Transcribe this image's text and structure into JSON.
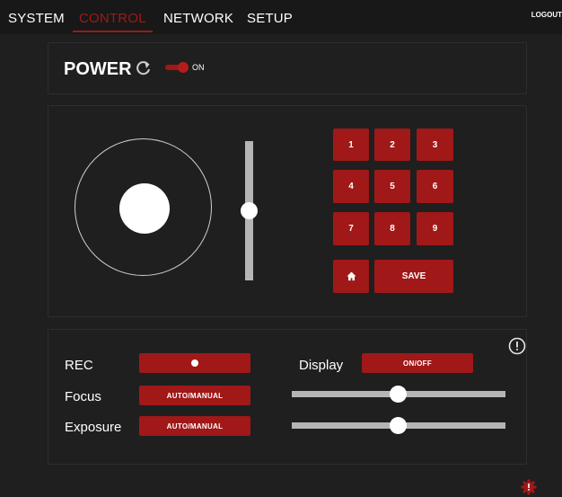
{
  "nav": {
    "tabs": [
      {
        "label": "SYSTEM"
      },
      {
        "label": "CONTROL"
      },
      {
        "label": "NETWORK"
      },
      {
        "label": "SETUP"
      }
    ],
    "active_tab": "CONTROL",
    "logout_label": "LOGOUT"
  },
  "power": {
    "label": "POWER",
    "refresh_icon": "refresh-icon",
    "toggle_state": "ON",
    "toggle_on": true
  },
  "ptz": {
    "joystick_icon": "joystick",
    "zoom_level": 0.5,
    "keypad": [
      "1",
      "2",
      "3",
      "4",
      "5",
      "6",
      "7",
      "8",
      "9"
    ],
    "home_icon": "home-icon",
    "save_label": "SAVE"
  },
  "settings": {
    "info_icon": "info-icon",
    "rec_label": "REC",
    "rec_icon": "record-dot",
    "focus_label": "Focus",
    "focus_button": "AUTO/MANUAL",
    "exposure_label": "Exposure",
    "exposure_button": "AUTO/MANUAL",
    "display_label": "Display",
    "display_button": "ON/OFF",
    "focus_level": 0.5,
    "exposure_level": 0.5
  },
  "footer": {
    "settings_icon": "gear-icon"
  },
  "colors": {
    "accent": "#a01818",
    "background": "#1f1f1f",
    "topbar": "#181818"
  }
}
